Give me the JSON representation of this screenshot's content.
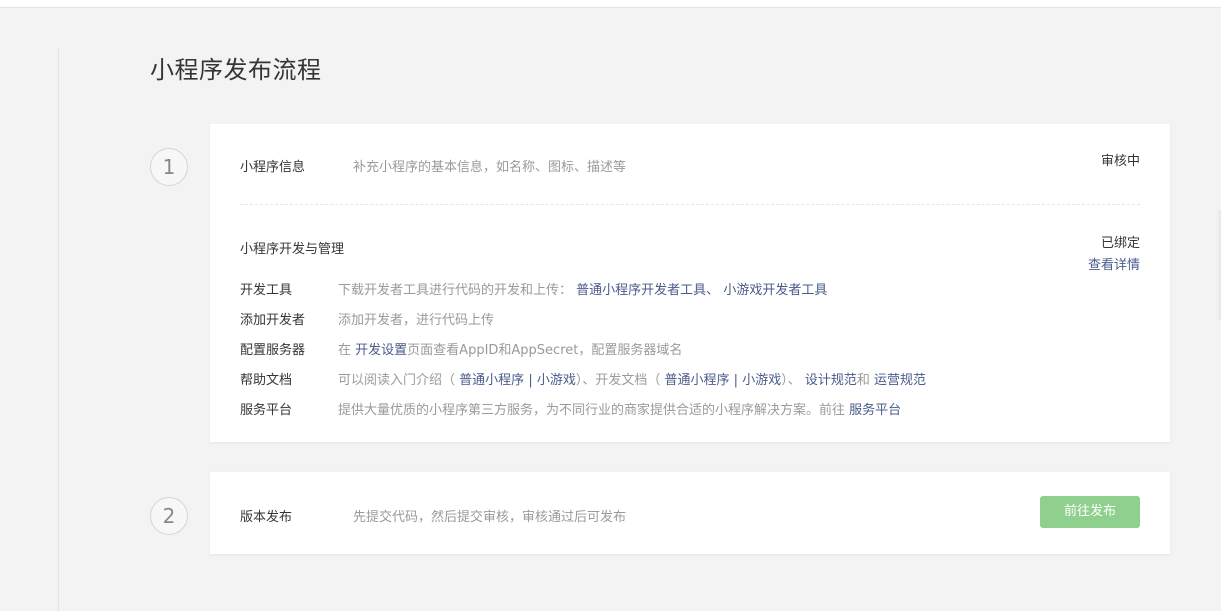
{
  "page": {
    "title": "小程序发布流程"
  },
  "steps": [
    {
      "number": "1"
    },
    {
      "number": "2"
    }
  ],
  "info": {
    "label": "小程序信息",
    "desc": "补充小程序的基本信息，如名称、图标、描述等",
    "status": "审核中"
  },
  "dev": {
    "label": "小程序开发与管理",
    "status": "已绑定",
    "detail_link": "查看详情",
    "rows": {
      "tools": {
        "label": "开发工具",
        "desc": "下载开发者工具进行代码的开发和上传：",
        "link1": "普通小程序开发者工具",
        "sep": "、",
        "link2": "小游戏开发者工具"
      },
      "developer": {
        "label": "添加开发者",
        "desc": "添加开发者，进行代码上传"
      },
      "server": {
        "label": "配置服务器",
        "prefix": "在",
        "link": "开发设置",
        "suffix": "页面查看AppID和AppSecret，配置服务器域名"
      },
      "docs": {
        "label": "帮助文档",
        "text1": "可以阅读入门介绍（",
        "link1": "普通小程序",
        "bar1": "|",
        "link2": "小游戏",
        "text2": "）、开发文档（",
        "link3": "普通小程序",
        "bar2": "|",
        "link4": "小游戏",
        "text3": "）、",
        "link5": "设计规范",
        "and": "和",
        "link6": "运营规范"
      },
      "service": {
        "label": "服务平台",
        "desc": "提供大量优质的小程序第三方服务，为不同行业的商家提供合适的小程序解决方案。前往",
        "link": "服务平台"
      }
    }
  },
  "release": {
    "label": "版本发布",
    "desc": "先提交代码，然后提交审核，审核通过后可发布",
    "button": "前往发布"
  }
}
